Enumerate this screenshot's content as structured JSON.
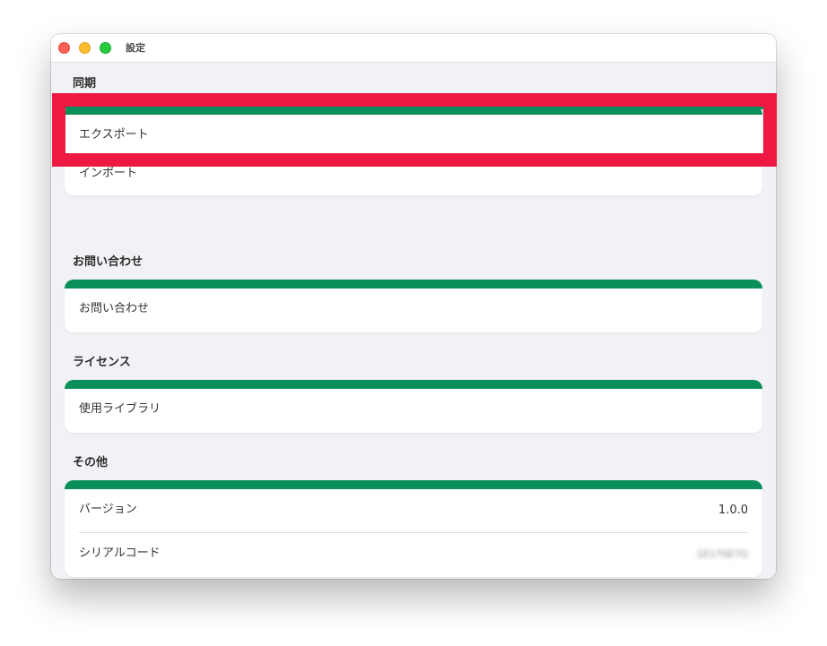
{
  "window": {
    "title": "設定"
  },
  "colors": {
    "accent": "#0a8f5b",
    "highlight": "#ee1943",
    "background": "#f2f2f6"
  },
  "sections": [
    {
      "title": "同期",
      "rows": [
        {
          "label": "エクスポート"
        },
        {
          "label": "インポート"
        }
      ]
    },
    {
      "title": "お問い合わせ",
      "rows": [
        {
          "label": "お問い合わせ"
        }
      ]
    },
    {
      "title": "ライセンス",
      "rows": [
        {
          "label": "使用ライブラリ"
        }
      ]
    },
    {
      "title": "その他",
      "rows": [
        {
          "label": "バージョン",
          "value": "1.0.0"
        },
        {
          "label": "シリアルコード",
          "value": "1E17SE7G"
        }
      ]
    }
  ]
}
